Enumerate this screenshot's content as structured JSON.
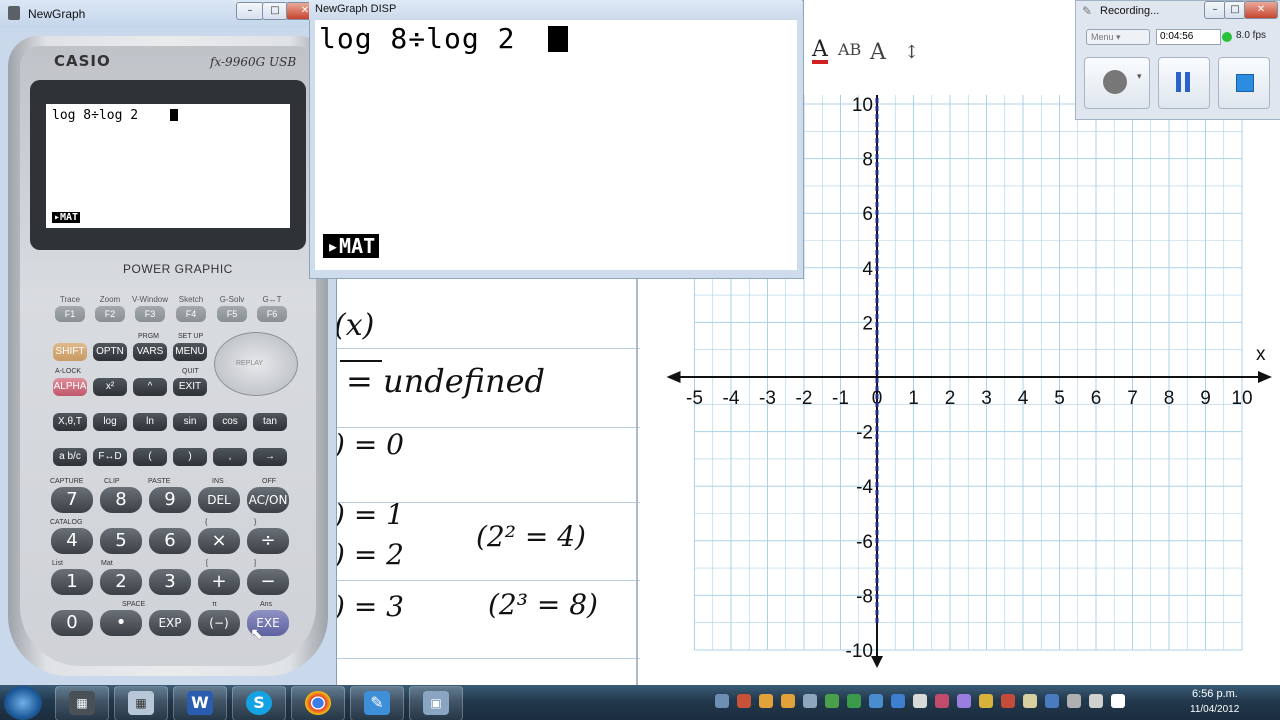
{
  "calculator": {
    "window_title": "NewGraph",
    "brand": "CASIO",
    "model": "fx-9960G USB",
    "screen_line": "log 8÷log 2",
    "screen_tag": "▸MAT",
    "panel_label": "POWER GRAPHIC",
    "function_labels": [
      "Trace",
      "Zoom",
      "V-Window",
      "Sketch",
      "G-Solv",
      "G↔T"
    ],
    "function_keys": [
      "F1",
      "F2",
      "F3",
      "F4",
      "F5",
      "F6"
    ],
    "row1": [
      "SHIFT",
      "OPTN",
      "VARS",
      "MENU"
    ],
    "row1_above": [
      "",
      "",
      "PRGM",
      "SET UP"
    ],
    "row2": [
      "ALPHA",
      "x²",
      "^",
      "EXIT"
    ],
    "row2_above": [
      "A-LOCK",
      "",
      "",
      "QUIT"
    ],
    "replay_label": "REPLAY",
    "row3": [
      "X,θ,T",
      "log",
      "ln",
      "sin",
      "cos",
      "tan"
    ],
    "row4": [
      "a b/c",
      "F↔D",
      "(",
      ")",
      ",",
      "→"
    ],
    "num_row1": [
      "7",
      "8",
      "9",
      "DEL",
      "AC/ON"
    ],
    "num_row1_above": [
      "CAPTURE",
      "CLIP",
      "PASTE",
      "INS",
      "OFF"
    ],
    "num_row2": [
      "4",
      "5",
      "6",
      "×",
      "÷"
    ],
    "num_row2_above": [
      "CATALOG",
      "",
      "",
      "{",
      "}"
    ],
    "num_row3": [
      "1",
      "2",
      "3",
      "+",
      "−"
    ],
    "num_row3_above": [
      "List",
      "Mat",
      "",
      "[",
      "]"
    ],
    "num_row4": [
      "0",
      "•",
      "EXP",
      "(−)",
      "EXE"
    ],
    "num_row4_above": [
      "",
      "",
      "SPACE",
      "π",
      "Ans"
    ]
  },
  "disp": {
    "window_title": "NewGraph DISP",
    "screen_line": "log 8÷log 2",
    "screen_tag": "▸MAT"
  },
  "notes": {
    "lines": [
      "(x)",
      "= undefined",
      ") = 0",
      ") = 1",
      ") = 2",
      "(2² = 4)",
      ") = 3",
      "(2³ = 8)"
    ]
  },
  "toolbar": {
    "icons": [
      "font-color-icon",
      "highlight-icon",
      "text-effect-icon",
      "line-spacing-icon"
    ]
  },
  "recorder": {
    "title": "Recording...",
    "menu_label": "Menu",
    "elapsed": "0:04:56",
    "fps": "8.0 fps"
  },
  "taskbar": {
    "apps": [
      "calculator",
      "calculator-2",
      "word",
      "skype",
      "chrome",
      "notes",
      "remote"
    ],
    "time": "6:56 p.m.",
    "date": "11/04/2012"
  },
  "chart_data": {
    "type": "line",
    "x_label": "x",
    "x_ticks": [
      "-5",
      "-4",
      "-3",
      "-2",
      "-1",
      "0",
      "1",
      "2",
      "3",
      "4",
      "5",
      "6",
      "7",
      "8",
      "9",
      "10"
    ],
    "y_ticks": [
      "10",
      "8",
      "6",
      "4",
      "2",
      "-2",
      "-4",
      "-6",
      "-8",
      "-10"
    ],
    "xlim": [
      -5,
      10
    ],
    "ylim": [
      -10,
      10
    ],
    "grid": true,
    "series": [
      {
        "style": "dashed",
        "color": "#1f2c8f",
        "x": [
          0,
          0
        ],
        "y": [
          -9,
          10
        ]
      }
    ]
  }
}
